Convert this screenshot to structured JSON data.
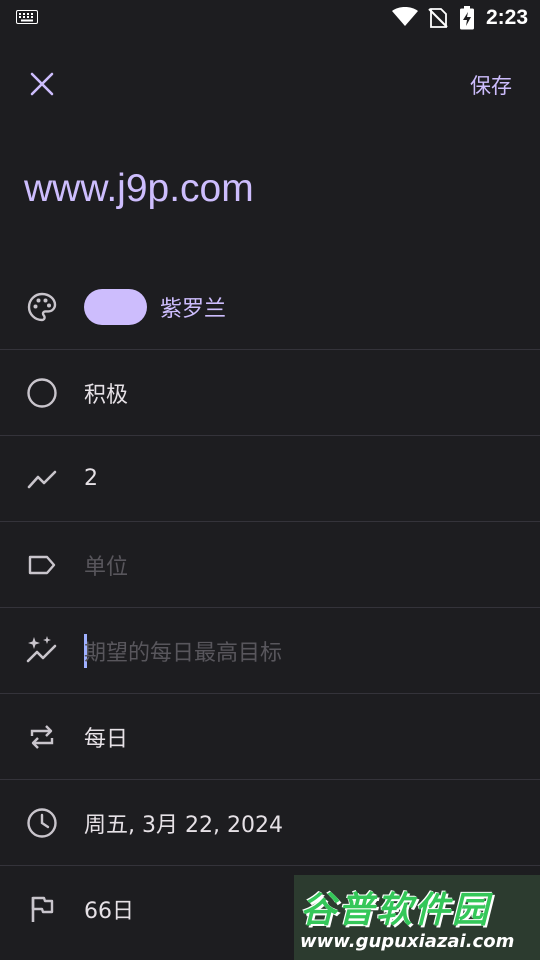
{
  "status_bar": {
    "time": "2:23",
    "icons": [
      "keyboard-icon",
      "wifi-icon",
      "no-sim-icon",
      "battery-charging-icon"
    ]
  },
  "toolbar": {
    "close_icon": "close-icon",
    "save_label": "保存"
  },
  "habit": {
    "name": "www.j9p.com"
  },
  "fields": {
    "color": {
      "icon": "palette-icon",
      "swatch_color": "#cdbdfd",
      "label": "紫罗兰"
    },
    "type": {
      "icon": "circle-outline-icon",
      "value": "积极"
    },
    "target": {
      "icon": "trending-up-icon",
      "value": "2"
    },
    "unit": {
      "icon": "label-icon",
      "placeholder": "单位"
    },
    "daily_goal": {
      "icon": "sparkle-trend-icon",
      "placeholder": "期望的每日最高目标"
    },
    "frequency": {
      "icon": "repeat-icon",
      "value": "每日"
    },
    "start_date": {
      "icon": "clock-icon",
      "value": "周五, 3月 22, 2024"
    },
    "duration": {
      "icon": "flag-icon",
      "value": "66日"
    }
  },
  "watermark": {
    "text": "谷普软件园",
    "url": "www.gupuxiazai.com"
  },
  "colors": {
    "background": "#1d1d20",
    "accent": "#cdbdfd",
    "text": "#e6e1e6",
    "placeholder": "#58565c",
    "divider": "#34333a",
    "icon": "#c9c5cc"
  }
}
